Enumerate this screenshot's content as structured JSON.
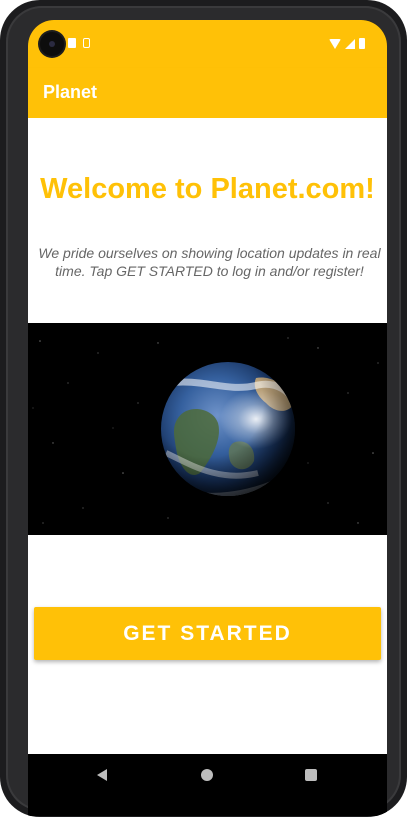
{
  "app": {
    "title": "Planet",
    "accent": "#FFC107"
  },
  "main": {
    "welcome": "Welcome to Planet.com!",
    "tagline": "We pride ourselves on showing location updates in real time. Tap GET STARTED to log in and/or register!",
    "button_label": "GET STARTED"
  },
  "icons": {
    "status_left": [
      "sim-card-icon",
      "notification-icon"
    ],
    "status_right": [
      "wifi-icon",
      "cell-signal-icon",
      "battery-icon"
    ],
    "nav": [
      "back-icon",
      "home-icon",
      "recents-icon"
    ]
  }
}
